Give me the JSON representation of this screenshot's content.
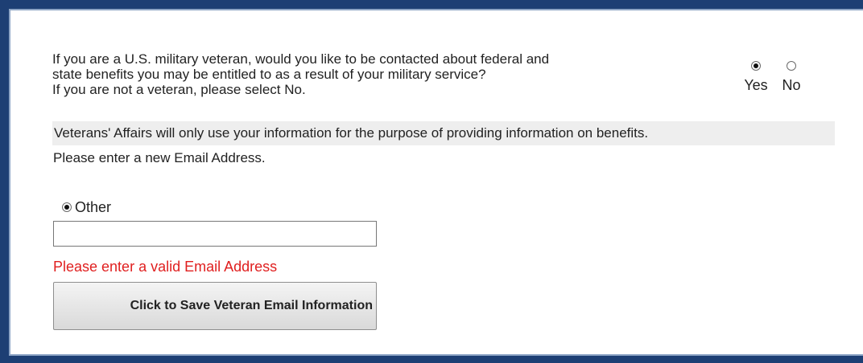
{
  "question": {
    "line1": "If you are a U.S. military veteran, would you like to be contacted about federal and",
    "line2": "state benefits you may be entitled to as a result of your military service?",
    "line3": "If you are not a veteran, please select No."
  },
  "veteran_choice": {
    "options": [
      {
        "label": "Yes",
        "selected": true
      },
      {
        "label": "No",
        "selected": false
      }
    ]
  },
  "notice": "Veterans' Affairs will only use your information for the purpose of providing information on benefits.",
  "email_prompt": "Please enter a new Email Address.",
  "email_option": {
    "label": "Other",
    "selected": true
  },
  "email_input": {
    "value": "",
    "placeholder": ""
  },
  "error_message": "Please enter a valid Email Address",
  "save_button": {
    "label": "Click to Save Veteran Email Information"
  },
  "colors": {
    "frame": "#1d3f74",
    "error": "#e01f1f",
    "notice_background": "#eeeeee"
  }
}
